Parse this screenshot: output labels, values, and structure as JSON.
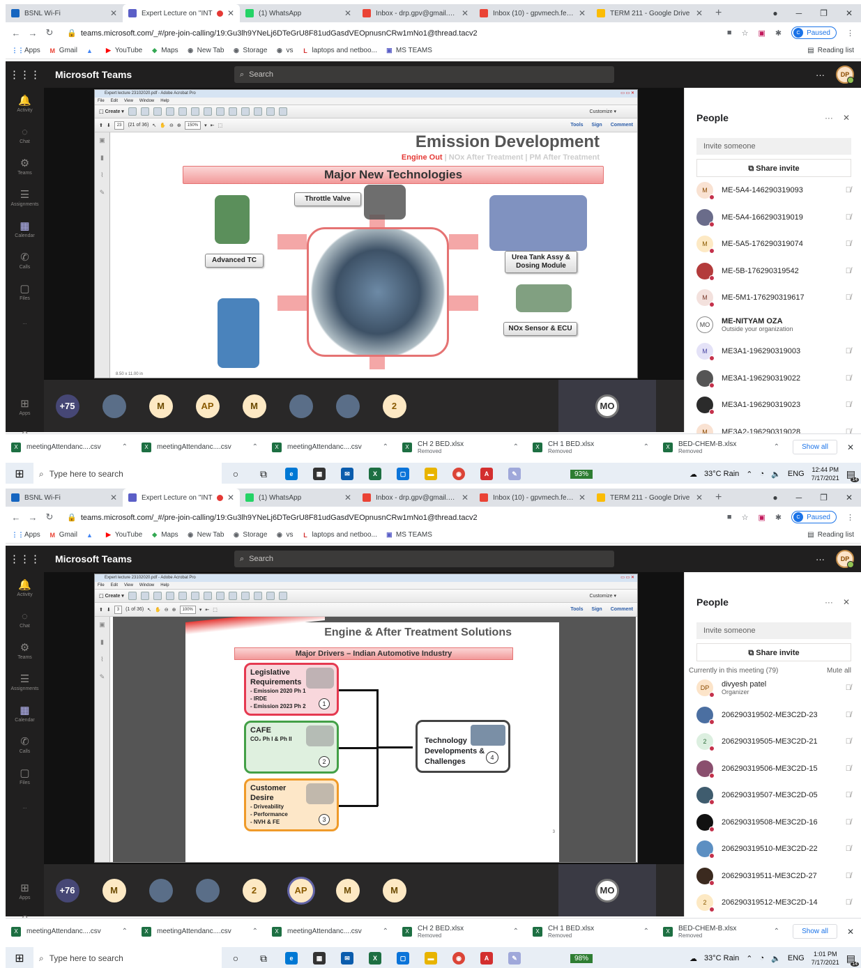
{
  "shots": [
    {
      "tabs": [
        {
          "title": "BSNL Wi-Fi",
          "icon": "bsnl-icon",
          "color": "#1565c0"
        },
        {
          "title": "Expert Lecture on ''INT",
          "icon": "teams-icon",
          "color": "#5b5fc7",
          "recording": true
        },
        {
          "title": "(1) WhatsApp",
          "icon": "whatsapp-icon",
          "color": "#25d366"
        },
        {
          "title": "Inbox - drp.gpv@gmail.com",
          "icon": "gmail-icon",
          "color": "#ea4335"
        },
        {
          "title": "Inbox (10) - gpvmech.feedb",
          "icon": "gmail-icon",
          "color": "#ea4335"
        },
        {
          "title": "TERM 211 - Google Drive",
          "icon": "drive-icon",
          "color": "#fbbc04"
        }
      ],
      "url": "teams.microsoft.com/_#/pre-join-calling/19:Gu3lh9YNeLj6DTeGrU8F81udGasdVEOpnusnCRw1mNo1@thread.tacv2",
      "paused_label": "Paused",
      "paused_initial": "C",
      "bookmarks": [
        "Apps",
        "Gmail",
        "",
        "YouTube",
        "Maps",
        "New Tab",
        "Storage",
        "vs",
        "laptops and netboo...",
        "MS TEAMS"
      ],
      "reading_list": "Reading list",
      "teams_title": "Microsoft Teams",
      "search_placeholder": "Search",
      "user_initials": "DP",
      "rail": [
        "Activity",
        "Chat",
        "Teams",
        "Assignments",
        "Calendar",
        "Calls",
        "Files",
        "...",
        "Apps",
        "Help"
      ],
      "acrobat": {
        "title": "Expert lecture 23102020.pdf - Adobe Acrobat Pro",
        "menu": [
          "File",
          "Edit",
          "View",
          "Window",
          "Help"
        ],
        "create": "Create",
        "page": "23",
        "of": "(21 of 36)",
        "zoom": "150%",
        "customize": "Customize",
        "tools": [
          "Tools",
          "Sign",
          "Comment"
        ]
      },
      "slide": {
        "title": "Emission Development",
        "sub_active": "Engine Out",
        "sub_rest": "| NOx After Treatment | PM After Treatment",
        "banner": "Major New Technologies",
        "labels": [
          "Throttle Valve",
          "Advanced TC",
          "Urea Tank Assy & Dosing Module",
          "NOx Sensor & ECU"
        ],
        "corner": "8.50 x 11.00 in"
      },
      "tiles": [
        "+75",
        "",
        "M",
        "AP",
        "M",
        "",
        "",
        "2",
        "MO"
      ],
      "people_title": "People",
      "invite": "Invite someone",
      "share": "Share invite",
      "section": "",
      "mute_all": "",
      "people": [
        {
          "name": "ME-5A4-146290319093",
          "initial": "M",
          "bg": "#f9e2d2",
          "fg": "#8a4a00"
        },
        {
          "name": "ME-5A4-166290319019",
          "initial": "",
          "bg": "#6a6c8a",
          "fg": "#fff"
        },
        {
          "name": "ME-5A5-176290319074",
          "initial": "M",
          "bg": "#fde9c4",
          "fg": "#8a5a00"
        },
        {
          "name": "ME-5B-176290319542",
          "initial": "",
          "bg": "#b33b3b",
          "fg": "#fff"
        },
        {
          "name": "ME-5M1-176290319617",
          "initial": "M",
          "bg": "#f3e1dd",
          "fg": "#7a3b2e"
        },
        {
          "name": "ME-NITYAM OZA",
          "initial": "MO",
          "bg": "#fff",
          "fg": "#444",
          "sub": "Outside your organization"
        },
        {
          "name": "ME3A1-196290319003",
          "initial": "M",
          "bg": "#e4e2f7",
          "fg": "#4a47a3"
        },
        {
          "name": "ME3A1-196290319022",
          "initial": "",
          "bg": "#555",
          "fg": "#fff"
        },
        {
          "name": "ME3A1-196290319023",
          "initial": "",
          "bg": "#2b2b2b",
          "fg": "#fff"
        },
        {
          "name": "ME3A2-196290319028",
          "initial": "M",
          "bg": "#f9e2d2",
          "fg": "#8a4a00"
        }
      ],
      "downloads": [
        {
          "name": "meetingAttendanc....csv",
          "sub": ""
        },
        {
          "name": "meetingAttendanc....csv",
          "sub": ""
        },
        {
          "name": "meetingAttendanc....csv",
          "sub": ""
        },
        {
          "name": "CH 2 BED.xlsx",
          "sub": "Removed"
        },
        {
          "name": "CH 1 BED.xlsx",
          "sub": "Removed"
        },
        {
          "name": "BED-CHEM-B.xlsx",
          "sub": "Removed"
        }
      ],
      "show_all": "Show all",
      "taskbar": {
        "search": "Type here to search",
        "battery": "93%",
        "weather": "33°C  Rain",
        "lang": "ENG",
        "time": "12:44 PM",
        "date": "7/17/2021",
        "notif": "14"
      }
    },
    {
      "tabs": [
        {
          "title": "BSNL Wi-Fi",
          "icon": "bsnl-icon",
          "color": "#1565c0"
        },
        {
          "title": "Expert Lecture on ''INT",
          "icon": "teams-icon",
          "color": "#5b5fc7",
          "recording": true
        },
        {
          "title": "(1) WhatsApp",
          "icon": "whatsapp-icon",
          "color": "#25d366"
        },
        {
          "title": "Inbox - drp.gpv@gmail.com",
          "icon": "gmail-icon",
          "color": "#ea4335"
        },
        {
          "title": "Inbox (10) - gpvmech.feedb",
          "icon": "gmail-icon",
          "color": "#ea4335"
        },
        {
          "title": "TERM 211 - Google Drive",
          "icon": "drive-icon",
          "color": "#fbbc04"
        }
      ],
      "url": "teams.microsoft.com/_#/pre-join-calling/19:Gu3lh9YNeLj6DTeGrU8F81udGasdVEOpnusnCRw1mNo1@thread.tacv2",
      "paused_label": "Paused",
      "paused_initial": "C",
      "bookmarks": [
        "Apps",
        "Gmail",
        "",
        "YouTube",
        "Maps",
        "New Tab",
        "Storage",
        "vs",
        "laptops and netboo...",
        "MS TEAMS"
      ],
      "reading_list": "Reading list",
      "teams_title": "Microsoft Teams",
      "search_placeholder": "Search",
      "user_initials": "DP",
      "rail": [
        "Activity",
        "Chat",
        "Teams",
        "Assignments",
        "Calendar",
        "Calls",
        "Files",
        "...",
        "Apps",
        "Help"
      ],
      "acrobat": {
        "title": "Expert lecture 23102020.pdf - Adobe Acrobat Pro",
        "menu": [
          "File",
          "Edit",
          "View",
          "Window",
          "Help"
        ],
        "create": "Create",
        "page": "3",
        "of": "(1 of 36)",
        "zoom": "100%",
        "customize": "Customize",
        "tools": [
          "Tools",
          "Sign",
          "Comment"
        ]
      },
      "slide": {
        "title": "Engine & After Treatment Solutions",
        "banner": "Major Drivers – Indian Automotive Industry",
        "boxes": [
          {
            "head": "Legislative Requirements",
            "lines": [
              "- Emission 2020 Ph 1",
              "- IRDE",
              "- Emission 2023 Ph 2"
            ],
            "num": "1"
          },
          {
            "head": "CAFE",
            "lines": [
              "CO₂ Ph I & Ph II"
            ],
            "num": "2"
          },
          {
            "head": "Customer Desire",
            "lines": [
              "- Driveability",
              "- Performance",
              "- NVH & FE"
            ],
            "num": "3"
          }
        ],
        "result": {
          "head": "Technology Developments & Challenges",
          "num": "4"
        },
        "pageno": "3"
      },
      "tiles": [
        "+76",
        "M",
        "",
        "",
        "2",
        "AP",
        "M",
        "M",
        "MO"
      ],
      "people_title": "People",
      "invite": "Invite someone",
      "share": "Share invite",
      "section": "Currently in this meeting (79)",
      "mute_all": "Mute all",
      "people": [
        {
          "name": "divyesh patel",
          "initial": "DP",
          "bg": "#fce4c9",
          "fg": "#8a4a00",
          "sub": "Organizer",
          "unmuted": true
        },
        {
          "name": "206290319502-ME3C2D-23",
          "initial": "",
          "bg": "#4b6fa1",
          "fg": "#fff"
        },
        {
          "name": "206290319505-ME3C2D-21",
          "initial": "2",
          "bg": "#dcefe0",
          "fg": "#2e6b3a"
        },
        {
          "name": "206290319506-ME3C2D-15",
          "initial": "",
          "bg": "#8a4f6e",
          "fg": "#fff"
        },
        {
          "name": "206290319507-ME3C2D-05",
          "initial": "",
          "bg": "#3f5c6e",
          "fg": "#fff"
        },
        {
          "name": "206290319508-ME3C2D-16",
          "initial": "",
          "bg": "#111",
          "fg": "#fff"
        },
        {
          "name": "206290319510-ME3C2D-22",
          "initial": "",
          "bg": "#5c8fc2",
          "fg": "#fff"
        },
        {
          "name": "206290319511-ME3C2D-27",
          "initial": "",
          "bg": "#3b2a1f",
          "fg": "#fff"
        },
        {
          "name": "206290319512-ME3C2D-14",
          "initial": "2",
          "bg": "#fde9c4",
          "fg": "#8a5a00"
        }
      ],
      "downloads": [
        {
          "name": "meetingAttendanc....csv",
          "sub": ""
        },
        {
          "name": "meetingAttendanc....csv",
          "sub": ""
        },
        {
          "name": "meetingAttendanc....csv",
          "sub": ""
        },
        {
          "name": "CH 2 BED.xlsx",
          "sub": "Removed"
        },
        {
          "name": "CH 1 BED.xlsx",
          "sub": "Removed"
        },
        {
          "name": "BED-CHEM-B.xlsx",
          "sub": "Removed"
        }
      ],
      "show_all": "Show all",
      "taskbar": {
        "search": "Type here to search",
        "battery": "98%",
        "weather": "33°C  Rain",
        "lang": "ENG",
        "time": "1:01 PM",
        "date": "7/17/2021",
        "notif": "14"
      }
    }
  ],
  "colors": {
    "teams_dark": "#201f1f",
    "teams_accent": "#5b5fc7",
    "slide_red": "#e53935",
    "chrome_blue": "#1a73e8"
  }
}
